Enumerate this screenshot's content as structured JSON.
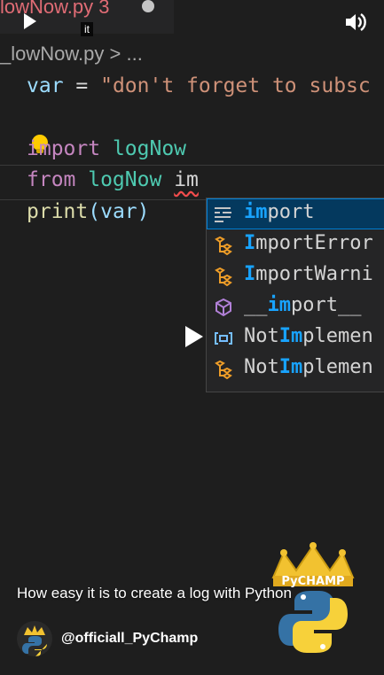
{
  "editor": {
    "tab_filename": "lowNow.py 3",
    "breadcrumb": "_lowNow.py > ...",
    "line1": {
      "name": "var",
      "op": " = ",
      "str": "\"don't forget to subsc"
    },
    "line3": {
      "kw": "import",
      "mod": " logNow"
    },
    "line4": {
      "kw": "from",
      "mod": " logNow",
      "typed": "im"
    },
    "line5": {
      "fn": "print",
      "open": "(",
      "arg": "var",
      "close": ")"
    }
  },
  "suggestions": [
    {
      "pre": "",
      "match": "im",
      "post": "port",
      "icon": "keyword-icon",
      "selected": true
    },
    {
      "pre": "",
      "match": "I",
      "post": "mportError",
      "icon": "class-icon",
      "selected": false
    },
    {
      "pre": "",
      "match": "I",
      "post": "mportWarni",
      "icon": "class-icon",
      "selected": false
    },
    {
      "pre": "__",
      "match": "im",
      "post": "port__",
      "icon": "method-cube-icon",
      "selected": false
    },
    {
      "pre": "Not",
      "match": "Im",
      "post": "plemen",
      "icon": "variable-icon",
      "selected": false
    },
    {
      "pre": "Not",
      "match": "Im",
      "post": "plemen",
      "icon": "class-icon",
      "selected": false
    }
  ],
  "overlay": {
    "cc_label": "it",
    "caption": "How easy it is to create a log with Python",
    "channel_handle": "@officiall_PyChamp",
    "watermark_text": "PyCHAMP"
  },
  "colors": {
    "keyword": "#c586c0",
    "string": "#ce9178",
    "module": "#4ec9b0",
    "function": "#dcdcaa",
    "variable": "#9cdcfe",
    "suggest_selected": "#04395e",
    "match_highlight": "#18a3ff",
    "error_squiggle": "#f14c4c"
  }
}
